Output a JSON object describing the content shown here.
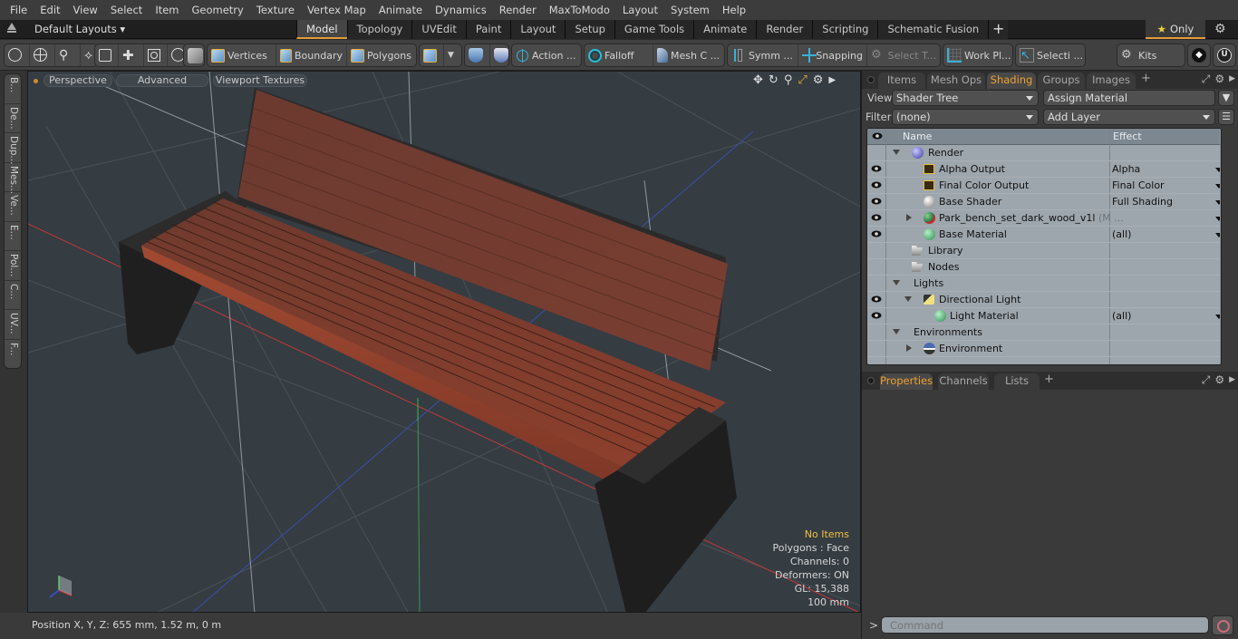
{
  "menubar": {
    "items": [
      "File",
      "Edit",
      "View",
      "Select",
      "Item",
      "Geometry",
      "Texture",
      "Vertex Map",
      "Animate",
      "Dynamics",
      "Render",
      "MaxToModo",
      "Layout",
      "System",
      "Help"
    ]
  },
  "layoutbar": {
    "layouts_label": "Default Layouts",
    "tabs": [
      {
        "label": "Model",
        "active": true
      },
      {
        "label": "Topology"
      },
      {
        "label": "UVEdit"
      },
      {
        "label": "Paint"
      },
      {
        "label": "Layout"
      },
      {
        "label": "Setup"
      },
      {
        "label": "Game Tools"
      },
      {
        "label": "Animate"
      },
      {
        "label": "Render"
      },
      {
        "label": "Scripting"
      },
      {
        "label": "Schematic Fusion"
      }
    ],
    "add_tab": "+",
    "only_label": "Only",
    "accent": "#e39a3a"
  },
  "toolbar": {
    "vertices": "Vertices",
    "boundary": "Boundary",
    "polygons": "Polygons",
    "action": "Action ...",
    "falloff": "Falloff",
    "mesh_c": "Mesh C ...",
    "symm": "Symm ...",
    "snapping": "Snapping",
    "select_t": "Select T...",
    "work_pl": "Work Pl...",
    "selecti": "Selecti ...",
    "kits": "Kits"
  },
  "left_tabs": [
    "B...",
    "De...",
    "Dup...",
    "Mes...",
    "Ve...",
    "E...",
    "Pol...",
    "C...",
    "UV...",
    "F..."
  ],
  "viewport": {
    "view_mode": "Perspective",
    "shading": "Advanced",
    "textures": "Viewport Textures",
    "info": {
      "selection": "No Items",
      "polygons": "Polygons : Face",
      "channels": "Channels: 0",
      "deformers": "Deformers: ON",
      "gl": "GL: 15,388",
      "grid": "100 mm"
    },
    "wood_color": "#8a3f2e",
    "frame_color": "#232323"
  },
  "status": {
    "position": "Position X, Y, Z:   655 mm, 1.52 m, 0 m"
  },
  "right_panel": {
    "tabs": [
      {
        "label": "Items"
      },
      {
        "label": "Mesh Ops"
      },
      {
        "label": "Shading",
        "active": true
      },
      {
        "label": "Groups"
      },
      {
        "label": "Images"
      }
    ],
    "add_tab": "+",
    "view_label": "View",
    "view_value": "Shader Tree",
    "assign_material": "Assign Material",
    "filter_label": "Filter",
    "filter_value": "(none)",
    "add_layer": "Add Layer",
    "tree": {
      "col_name": "Name",
      "col_effect": "Effect",
      "rows": [
        {
          "name": "Render",
          "effect": "",
          "eye": false
        },
        {
          "name": "Alpha Output",
          "effect": "Alpha",
          "eye": true
        },
        {
          "name": "Final Color Output",
          "effect": "Final Color",
          "eye": true
        },
        {
          "name": "Base Shader",
          "effect": "Full Shading",
          "eye": true
        },
        {
          "name": "Park_bench_set_dark_wood_v1l",
          "sub": "(M ...",
          "effect": "",
          "eye": true
        },
        {
          "name": "Base Material",
          "effect": "(all)",
          "eye": true
        },
        {
          "name": "Library",
          "effect": "",
          "eye": false
        },
        {
          "name": "Nodes",
          "effect": "",
          "eye": false
        },
        {
          "name": "Lights",
          "effect": "",
          "eye": false
        },
        {
          "name": "Directional Light",
          "effect": "",
          "eye": true
        },
        {
          "name": "Light Material",
          "effect": "(all)",
          "eye": true
        },
        {
          "name": "Environments",
          "effect": "",
          "eye": false
        },
        {
          "name": "Environment",
          "effect": "",
          "eye": false
        }
      ]
    },
    "bottom_tabs": [
      {
        "label": "Properties",
        "active": true
      },
      {
        "label": "Channels"
      },
      {
        "label": "Lists"
      }
    ],
    "command_placeholder": "Command",
    "command_prompt": ">"
  }
}
